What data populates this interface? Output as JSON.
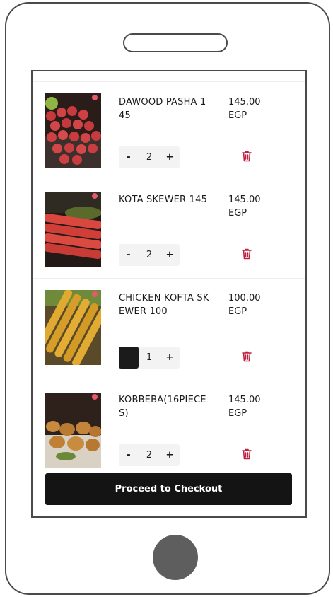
{
  "cart": {
    "items": [
      {
        "name": "DAWOOD PASHA 145",
        "price": "145.00 EGP",
        "quantity": "2",
        "decrement": "-",
        "increment": "+",
        "image": "meatballs-image"
      },
      {
        "name": "KOTA SKEWER 145",
        "price": "145.00 EGP",
        "quantity": "2",
        "decrement": "-",
        "increment": "+",
        "image": "kofta-skewers-image"
      },
      {
        "name": "CHICKEN KOFTA SKEWER 100",
        "price": "100.00 EGP",
        "quantity": "1",
        "decrement": "-",
        "increment": "+",
        "image": "chicken-skewers-image"
      },
      {
        "name": "KOBBEBA(16PIECES)",
        "price": "145.00 EGP",
        "quantity": "2",
        "decrement": "-",
        "increment": "+",
        "image": "kibbeh-image"
      }
    ]
  },
  "checkout": {
    "label": "Proceed to Checkout"
  },
  "colors": {
    "trash": "#c0203f",
    "button": "#141414",
    "frame": "#4a4a4a"
  },
  "icons": {
    "delete": "trash-icon"
  }
}
